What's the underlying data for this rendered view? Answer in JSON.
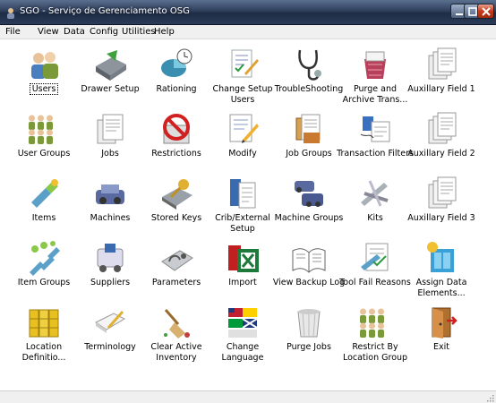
{
  "window": {
    "title": "SGO - Serviço de Gerenciamento OSG",
    "colors": {
      "titlebar": "#2f3f5c",
      "close": "#c43b1b"
    }
  },
  "menu": [
    {
      "label": "File"
    },
    {
      "label": "View"
    },
    {
      "label": "Data"
    },
    {
      "label": "Config"
    },
    {
      "label": "Utilities"
    },
    {
      "label": "Help"
    }
  ],
  "tiles": [
    {
      "label": "Users",
      "icon": "users-icon",
      "selected": true
    },
    {
      "label": "Drawer Setup",
      "icon": "drawer-setup-icon"
    },
    {
      "label": "Rationing",
      "icon": "rationing-icon"
    },
    {
      "label": "Change Setup Users",
      "icon": "change-setup-users-icon"
    },
    {
      "label": "TroubleShooting",
      "icon": "stethoscope-icon"
    },
    {
      "label": "Purge and Archive Trans...",
      "icon": "purge-archive-icon"
    },
    {
      "label": "Auxillary Field 1",
      "icon": "documents-icon"
    },
    {
      "label": "User Groups",
      "icon": "user-groups-icon"
    },
    {
      "label": "Jobs",
      "icon": "jobs-icon"
    },
    {
      "label": "Restrictions",
      "icon": "restrictions-icon"
    },
    {
      "label": "Modify",
      "icon": "modify-icon"
    },
    {
      "label": "Job Groups",
      "icon": "job-groups-icon"
    },
    {
      "label": "Transaction Filters",
      "icon": "transaction-filters-icon"
    },
    {
      "label": "Auxillary Field 2",
      "icon": "documents-icon"
    },
    {
      "label": "Items",
      "icon": "items-icon"
    },
    {
      "label": "Machines",
      "icon": "machines-icon"
    },
    {
      "label": "Stored Keys",
      "icon": "stored-keys-icon"
    },
    {
      "label": "Crib/External Setup",
      "icon": "crib-external-icon"
    },
    {
      "label": "Machine Groups",
      "icon": "machine-groups-icon"
    },
    {
      "label": "Kits",
      "icon": "kits-icon"
    },
    {
      "label": "Auxillary Field 3",
      "icon": "documents-icon"
    },
    {
      "label": "Item Groups",
      "icon": "item-groups-icon"
    },
    {
      "label": "Suppliers",
      "icon": "suppliers-icon"
    },
    {
      "label": "Parameters",
      "icon": "parameters-icon"
    },
    {
      "label": "Import",
      "icon": "excel-import-icon"
    },
    {
      "label": "View Backup Log",
      "icon": "book-icon"
    },
    {
      "label": "Tool Fail Reasons",
      "icon": "tool-fail-icon"
    },
    {
      "label": "Assign Data Elements...",
      "icon": "assign-data-icon"
    },
    {
      "label": "Location Definitio...",
      "icon": "location-icon"
    },
    {
      "label": "Terminology",
      "icon": "terminology-icon"
    },
    {
      "label": "Clear Active Inventory",
      "icon": "broom-icon"
    },
    {
      "label": "Change Language",
      "icon": "flags-icon"
    },
    {
      "label": "Purge Jobs",
      "icon": "wastebasket-icon"
    },
    {
      "label": "Restrict By Location Group",
      "icon": "restrict-location-icon"
    },
    {
      "label": "Exit",
      "icon": "exit-door-icon"
    }
  ]
}
